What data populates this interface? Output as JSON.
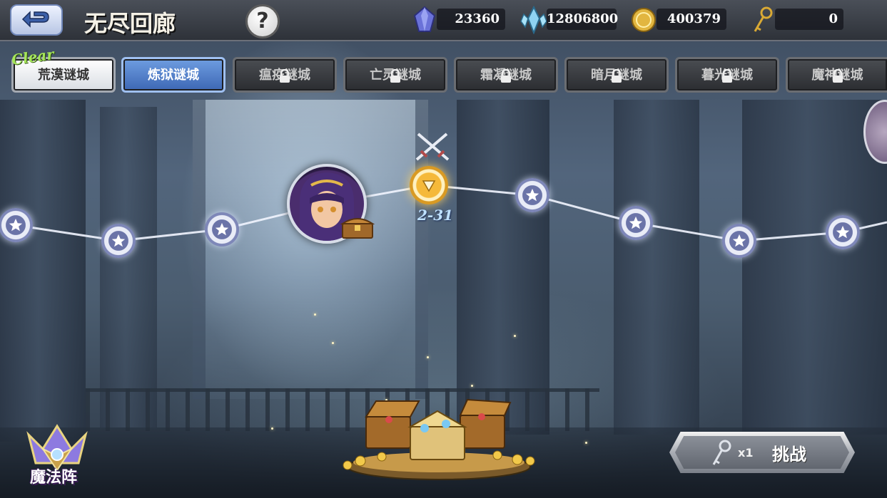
{
  "header": {
    "title": "无尽回廊",
    "help_label": "?",
    "currencies": [
      {
        "icon": "purple-gem-icon",
        "value": "23360"
      },
      {
        "icon": "blue-crystal-icon",
        "value": "12806800"
      },
      {
        "icon": "gold-coin-icon",
        "value": "400379"
      },
      {
        "icon": "gold-key-icon",
        "value": "0"
      }
    ]
  },
  "tabs": [
    {
      "label": "荒漠谜城",
      "state": "cleared",
      "badge": "Clear"
    },
    {
      "label": "炼狱谜城",
      "state": "active"
    },
    {
      "label": "瘟疫谜城",
      "state": "locked"
    },
    {
      "label": "亡灵谜城",
      "state": "locked"
    },
    {
      "label": "霜凝谜城",
      "state": "locked"
    },
    {
      "label": "暗月谜城",
      "state": "locked"
    },
    {
      "label": "暮光谜城",
      "state": "locked"
    },
    {
      "label": "魔神谜城",
      "state": "locked"
    }
  ],
  "path": {
    "current_stage": "2-31"
  },
  "magic_array": {
    "label": "魔法阵"
  },
  "challenge": {
    "count": "x1",
    "label": "挑战"
  },
  "colors": {
    "active_tab": "#3d67b5",
    "clear_badge": "#a6e65a",
    "stage_label": "#bfe1ff",
    "current_node": "#f5b93a"
  }
}
